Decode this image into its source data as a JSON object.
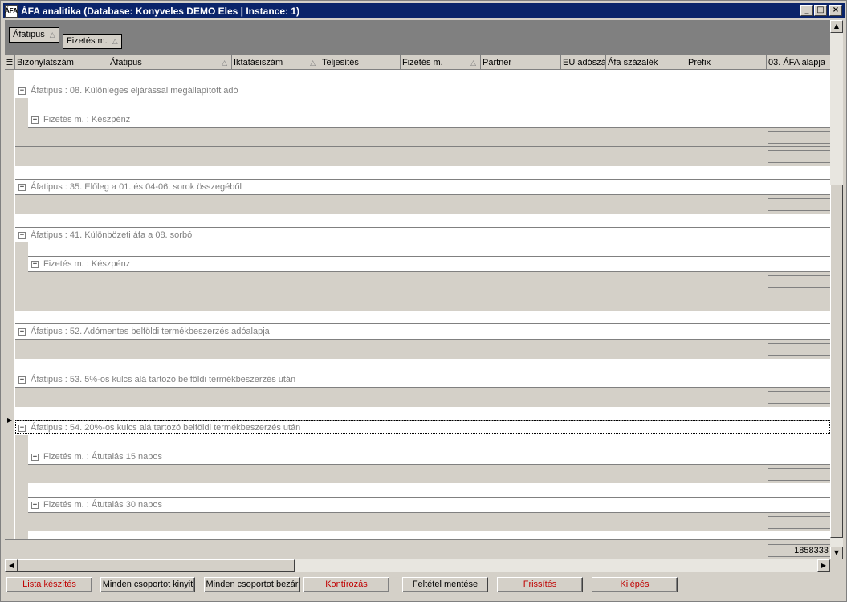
{
  "window": {
    "icon_text": "ÁFA",
    "title": "ÁFA analitika  (Database: Konyveles DEMO  Eles | Instance: 1)",
    "minimize": "_",
    "maximize": "□",
    "close": "×"
  },
  "group_panel": {
    "chips": [
      {
        "label": "Áfatipus"
      },
      {
        "label": "Fizetés m."
      }
    ]
  },
  "columns": [
    {
      "label": "Bizonylatszám"
    },
    {
      "label": "Áfatipus"
    },
    {
      "label": "Iktatásiszám"
    },
    {
      "label": "Teljesítés"
    },
    {
      "label": "Fizetés m."
    },
    {
      "label": "Partner"
    },
    {
      "label": "EU adószá"
    },
    {
      "label": "Áfa százalék"
    },
    {
      "label": "Prefix"
    },
    {
      "label": "03. ÁFA alapja"
    }
  ],
  "groups": [
    {
      "label": "Áfatipus : 08. Különleges eljárással megállapított adó",
      "expanded": true,
      "children": [
        {
          "label": "Fizetés m. : Készpénz"
        }
      ]
    },
    {
      "label": "Áfatipus : 35. Előleg a 01. és 04-06. sorok összegéből",
      "expanded": false,
      "children": []
    },
    {
      "label": "Áfatipus : 41. Különbözeti áfa a 08. sorból",
      "expanded": true,
      "children": [
        {
          "label": "Fizetés m. : Készpénz"
        }
      ]
    },
    {
      "label": "Áfatipus : 52. Adómentes belföldi termékbeszerzés adóalapja",
      "expanded": false,
      "children": []
    },
    {
      "label": "Áfatipus : 53. 5%-os kulcs alá tartozó belföldi termékbeszerzés után",
      "expanded": false,
      "children": []
    },
    {
      "label": "Áfatipus : 54. 20%-os kulcs alá tartozó belföldi termékbeszerzés után",
      "expanded": true,
      "children": [
        {
          "label": "Fizetés m. : Átutalás 15 napos"
        },
        {
          "label": "Fizetés m. : Átutalás 30 napos"
        }
      ]
    }
  ],
  "expand_symbol": "+",
  "collapse_symbol": "−",
  "grand_total": "1858333",
  "buttons": {
    "lista_hot": "L",
    "lista_rest": "ista készítés",
    "kinyit": "Minden csoportot kinyit",
    "bezar": "Minden csoportot bezár",
    "kontir_pre": "Kon",
    "kontir_hot": "t",
    "kontir_rest": "írozás",
    "mentes": "Feltétel mentése",
    "friss_hot": "F",
    "friss_rest": "rissítés",
    "kilep_pre": "Ki",
    "kilep_hot": "l",
    "kilep_rest": "épés"
  }
}
